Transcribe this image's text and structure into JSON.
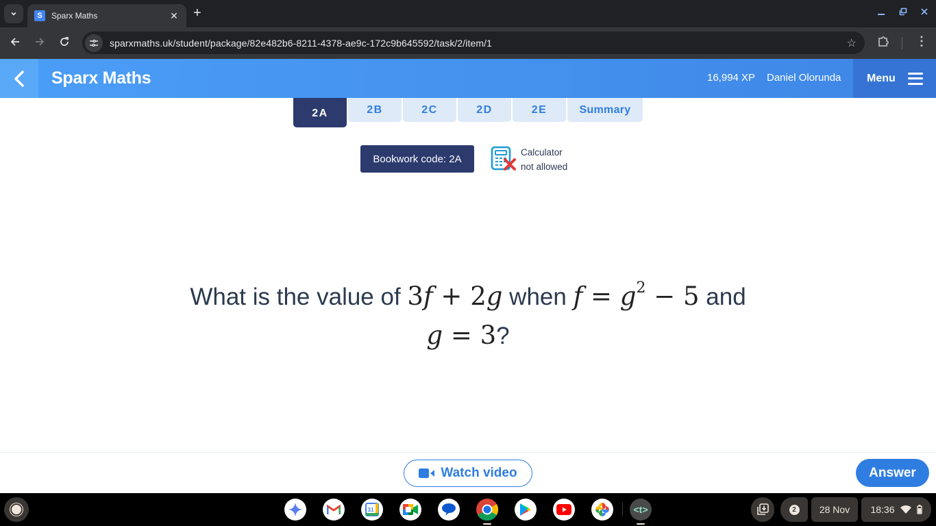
{
  "browser": {
    "tab_title": "Sparx Maths",
    "favicon_letter": "S",
    "url": "sparxmaths.uk/student/package/82e482b6-8211-4378-ae9c-172c9b645592/task/2/item/1",
    "icons": {
      "tab_search": "chevron-down-icon",
      "tab_close": "close-icon",
      "new_tab": "plus-icon",
      "back": "arrow-left-icon",
      "forward": "arrow-right-icon",
      "reload": "reload-icon",
      "site_info": "tune-icon",
      "bookmark": "star-icon",
      "extensions": "puzzle-icon",
      "menu": "kebab-icon",
      "minimize": "minimize-icon",
      "restore": "restore-icon",
      "close": "close-icon"
    }
  },
  "header": {
    "brand": "Sparx Maths",
    "xp": "16,994 XP",
    "username": "Daniel Olorunda",
    "menu_label": "Menu"
  },
  "task_tabs": [
    {
      "label": "2A",
      "active": true
    },
    {
      "label": "2B",
      "active": false
    },
    {
      "label": "2C",
      "active": false
    },
    {
      "label": "2D",
      "active": false
    },
    {
      "label": "2E",
      "active": false
    },
    {
      "label": "Summary",
      "active": false
    }
  ],
  "bookwork": {
    "label": "Bookwork code: 2A",
    "calculator_line1": "Calculator",
    "calculator_line2": "not allowed"
  },
  "question": {
    "prefix": "What is the value of ",
    "expr1_coef": "3",
    "expr1_var": "f",
    "expr1_op": " + ",
    "expr1_coef2": "2",
    "expr1_var2": "g",
    "mid": " when ",
    "eq1_lhs": "f",
    "eq1_eq": " = ",
    "eq1_base": "g",
    "eq1_exp": "2",
    "eq1_rest": " − 5",
    "conj": " and",
    "eq2_lhs": "g",
    "eq2_eq": " = ",
    "eq2_rhs": "3",
    "suffix": "?"
  },
  "footer": {
    "watch_video_label": "Watch video",
    "answer_label": "Answer"
  },
  "shelf": {
    "apps": [
      "Gemini",
      "Gmail",
      "Calendar",
      "Meet",
      "Messages",
      "Chrome",
      "Play Store",
      "YouTube",
      "Photos",
      "Text"
    ],
    "calendar_day": "31",
    "notification_count": "2",
    "date": "28 Nov",
    "time": "18:36"
  },
  "colors": {
    "brand_blue": "#3e86e6",
    "navy": "#2c3a6e",
    "accent_blue": "#2f7de1",
    "tab_inactive_bg": "#deeaf7",
    "no_calc_red": "#e53935"
  }
}
